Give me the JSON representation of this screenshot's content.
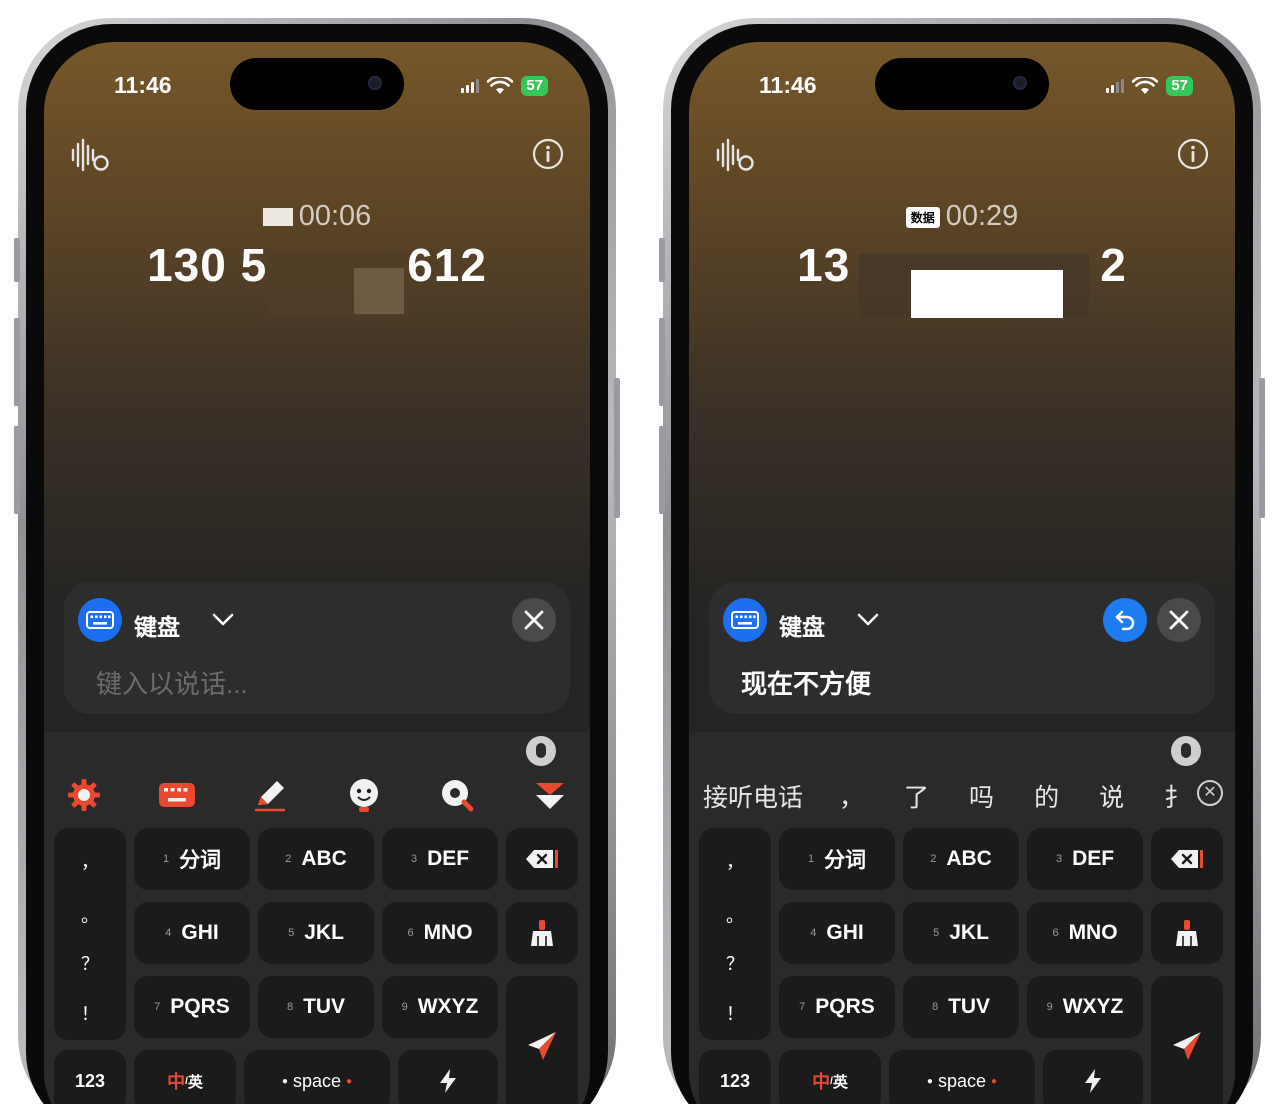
{
  "phones": [
    {
      "id": "left",
      "status": {
        "time": "11:46",
        "battery": "57"
      },
      "timer": "00:06",
      "number": {
        "head": "130 5",
        "tail": "612"
      },
      "panel": {
        "title": "键盘",
        "placeholder": "键入以说话...",
        "value": ""
      },
      "candidates": []
    },
    {
      "id": "right",
      "status": {
        "time": "11:46",
        "battery": "57"
      },
      "timer": "00:29",
      "tag": "数据",
      "number": {
        "head": "13",
        "tail": "2"
      },
      "panel": {
        "title": "键盘",
        "placeholder": "",
        "value": "现在不方便"
      },
      "candidates": [
        "接听电话",
        "，",
        "了",
        "吗",
        "的",
        "说",
        "扌"
      ]
    }
  ],
  "keyboard": {
    "punct": [
      "，",
      "。",
      "？",
      "！"
    ],
    "keys": [
      {
        "num": "1",
        "label": "分词"
      },
      {
        "num": "2",
        "label": "ABC"
      },
      {
        "num": "3",
        "label": "DEF"
      },
      {
        "num": "4",
        "label": "GHI"
      },
      {
        "num": "5",
        "label": "JKL"
      },
      {
        "num": "6",
        "label": "MNO"
      },
      {
        "num": "7",
        "label": "PQRS"
      },
      {
        "num": "8",
        "label": "TUV"
      },
      {
        "num": "9",
        "label": "WXYZ"
      }
    ],
    "bottom": {
      "num_mode": "123",
      "lang_cn": "中",
      "lang_sep": "/",
      "lang_en": "英",
      "space": "space"
    }
  },
  "icons": [
    "voice-wave-icon",
    "info-icon",
    "keyboard-icon",
    "chevron-down-icon",
    "close-icon",
    "undo-icon",
    "settings-icon",
    "pencil-icon",
    "emoji-icon",
    "search-icon",
    "collapse-icon",
    "mic-icon",
    "backspace-icon",
    "clear-icon",
    "send-icon",
    "bolt-icon"
  ],
  "colors": {
    "accent_blue": "#1d6ff2",
    "accent_red": "#e8492f",
    "battery_green": "#34c759"
  }
}
